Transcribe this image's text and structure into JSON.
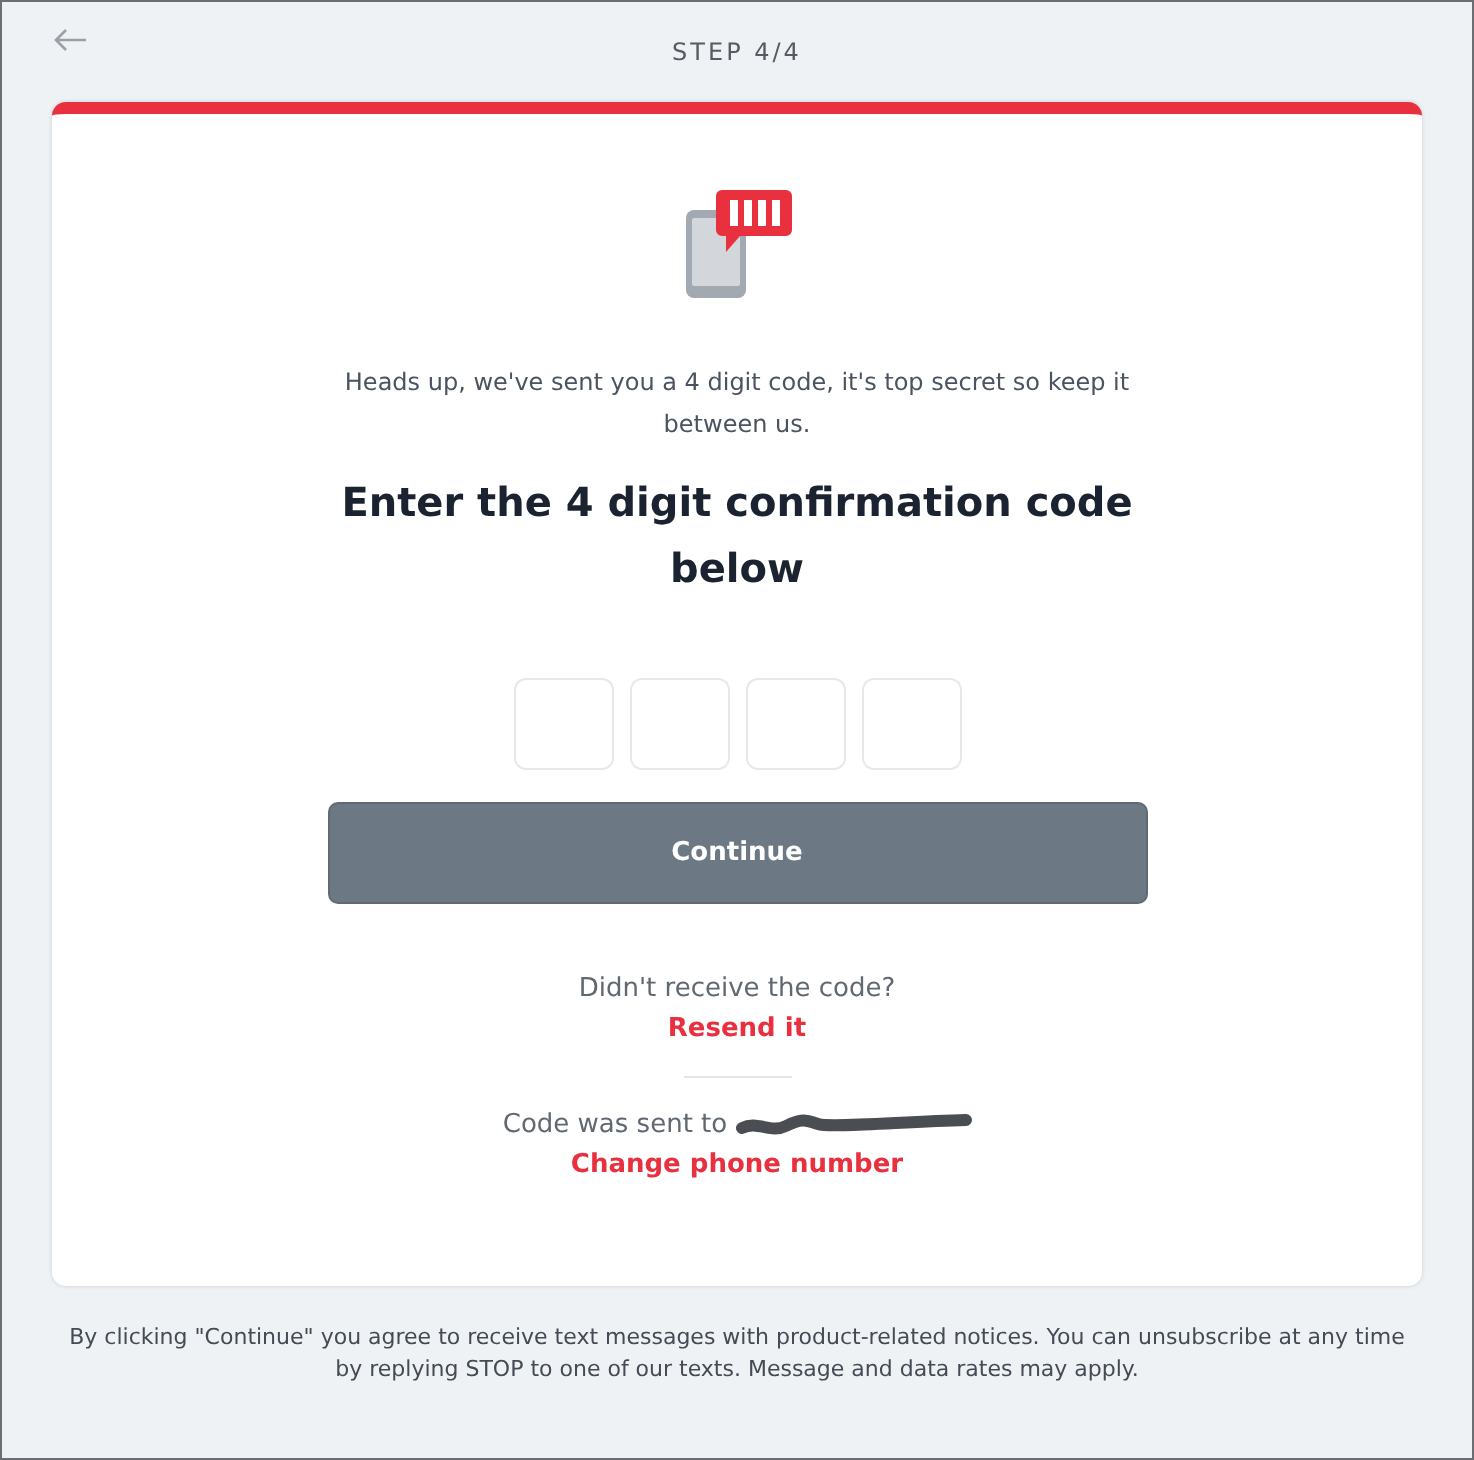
{
  "header": {
    "step": "STEP 4/4"
  },
  "card": {
    "intro": "Heads up, we've sent you a 4 digit code, it's top secret so keep it between us.",
    "heading": "Enter the 4 digit confirmation code below",
    "code_fields": [
      {
        "kind": "digit"
      },
      {
        "kind": "digit"
      },
      {
        "kind": "digit"
      },
      {
        "kind": "digit"
      }
    ],
    "button": {
      "label": "Continue",
      "disabled": true
    },
    "resend_prompt": "Didn't receive the code?",
    "resend_link": "Resend it",
    "sent_to": "Code was sent to",
    "change_link": "Change phone number"
  },
  "footer": "By clicking \"Continue\" you agree to receive text messages with product-related notices. You can unsubscribe at any time by replying STOP to one of our texts. Message and data rates may apply."
}
